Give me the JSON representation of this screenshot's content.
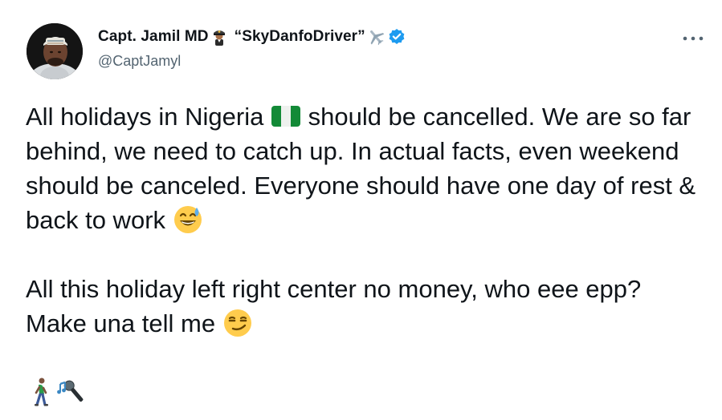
{
  "author": {
    "display_name": "Capt. Jamil MD",
    "nickname": "“SkyDanfoDriver”",
    "handle": "@CaptJamyl",
    "verified": true,
    "name_emojis": [
      "pilot-icon",
      "airplane-icon"
    ]
  },
  "tweet": {
    "paragraphs": [
      {
        "segments": [
          {
            "text": "All holidays in Nigeria "
          },
          {
            "emoji": "nigeria-flag-icon"
          },
          {
            "text": " should be cancelled. We are so far behind, we need to catch up. In actual facts, even weekend should be canceled. Everyone should have one day of rest & back to work "
          },
          {
            "emoji": "grinning-sweat-face-icon"
          }
        ]
      },
      {
        "segments": [
          {
            "text": "All this holiday left right center no money, who eee epp? Make una tell me "
          },
          {
            "emoji": "smirking-face-icon"
          }
        ]
      },
      {
        "segments": [
          {
            "emoji": "person-walking-icon"
          },
          {
            "emoji": "microphone-music-icon"
          }
        ]
      }
    ]
  },
  "colors": {
    "text": "#0f1419",
    "secondary": "#536471",
    "verified_blue": "#1d9bf0"
  },
  "menu": {
    "more_icon": "more-options-icon"
  }
}
